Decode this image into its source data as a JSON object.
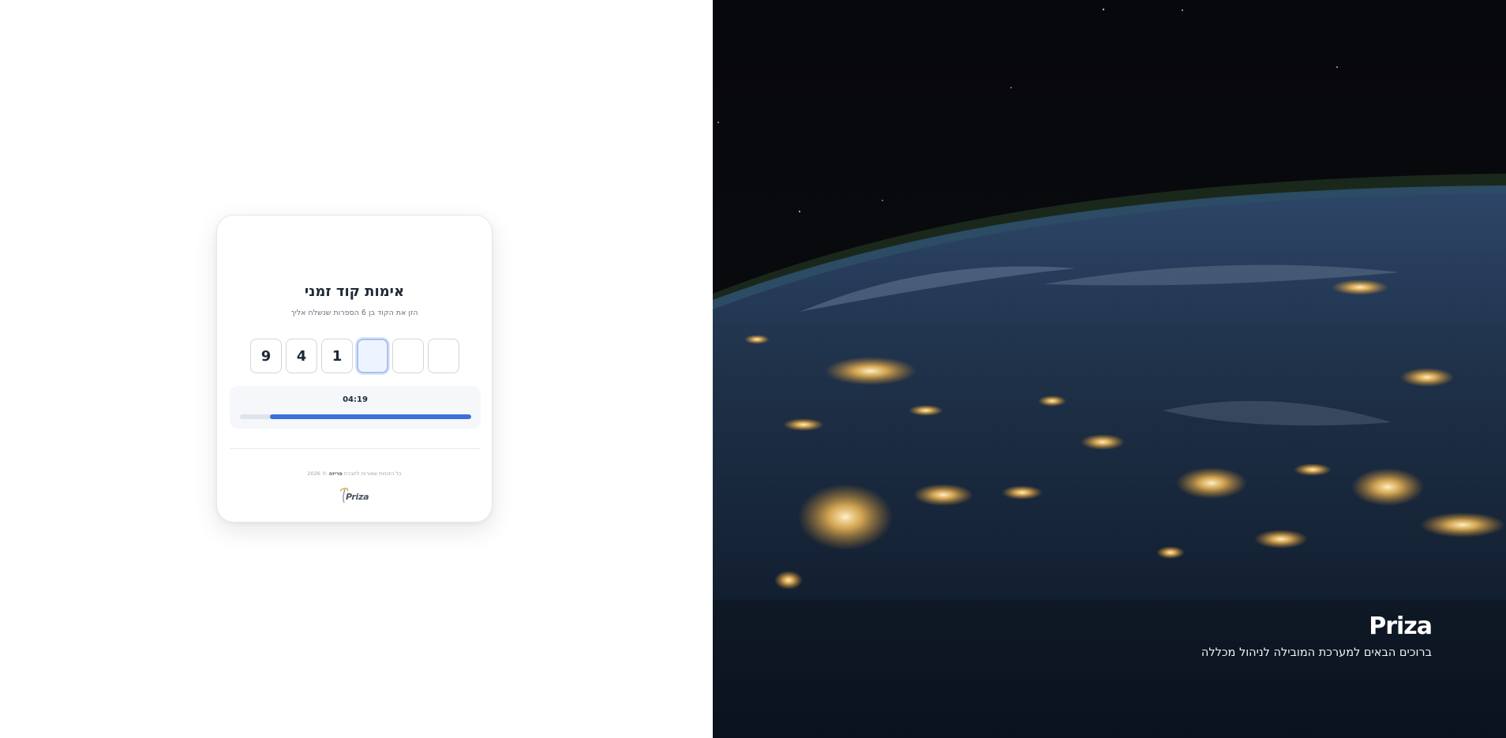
{
  "verification": {
    "title": "אימות קוד זמני",
    "instructions": "הזן את הקוד בן 6 הספרות שנשלח אליך",
    "digits": [
      "9",
      "4",
      "1",
      "",
      "",
      ""
    ],
    "active_digit_index": 3,
    "timer": "04:19",
    "timer_progress": 0.87,
    "copyright_prefix": "כל הזכויות שמורות לחברת",
    "copyright_company": "פריזה",
    "copyright_suffix": "© 2026",
    "footer_logo_text": "Priza"
  },
  "hero": {
    "brand": "Priza",
    "tagline": "ברוכים הבאים למערכת המובילה לניהול מכללה"
  },
  "colors": {
    "accent": "#3b6fd9",
    "text": "#1f2937",
    "muted": "#6b7280"
  }
}
